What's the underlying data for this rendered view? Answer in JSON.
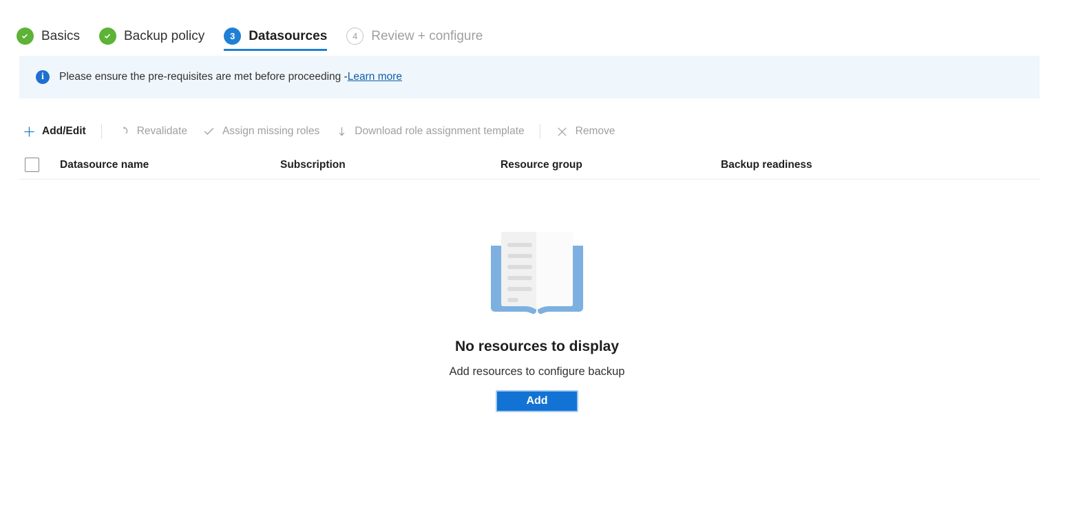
{
  "wizard": {
    "tabs": [
      {
        "label": "Basics",
        "state": "done",
        "icon": "check-circle-icon",
        "num": ""
      },
      {
        "label": "Backup policy",
        "state": "done",
        "icon": "check-circle-icon",
        "num": ""
      },
      {
        "label": "Datasources",
        "state": "active",
        "icon": "step-number-icon",
        "num": "3"
      },
      {
        "label": "Review + configure",
        "state": "todo",
        "icon": "step-number-icon",
        "num": "4"
      }
    ]
  },
  "banner": {
    "icon": "info-icon",
    "text": "Please ensure the pre-requisites are met before proceeding - ",
    "link_label": "Learn more",
    "background": "#eff6fc",
    "icon_color": "#1f6fd0",
    "link_color": "#0f5ea8"
  },
  "toolbar": {
    "commands": [
      {
        "label": "Add/Edit",
        "icon": "plus-icon",
        "enabled": true
      },
      {
        "label": "Revalidate",
        "icon": "refresh-icon",
        "enabled": false
      },
      {
        "label": "Assign missing roles",
        "icon": "checkmark-icon",
        "enabled": false
      },
      {
        "label": "Download role assignment template",
        "icon": "download-icon",
        "enabled": false
      },
      {
        "label": "Remove",
        "icon": "close-icon",
        "enabled": false
      }
    ]
  },
  "table": {
    "select_all_checked": false,
    "columns": [
      "Datasource name",
      "Subscription",
      "Resource group",
      "Backup readiness"
    ],
    "rows": []
  },
  "empty_state": {
    "illustration": "open-book-icon",
    "title": "No resources to display",
    "subtitle": "Add resources to configure backup",
    "button_label": "Add",
    "button_color": "#1273d4"
  },
  "colors": {
    "accent": "#1f7fd4",
    "success": "#5cb335",
    "disabled_text": "#a19f9d",
    "book_cover": "#7db0e0",
    "book_line": "#dcdcdc"
  }
}
